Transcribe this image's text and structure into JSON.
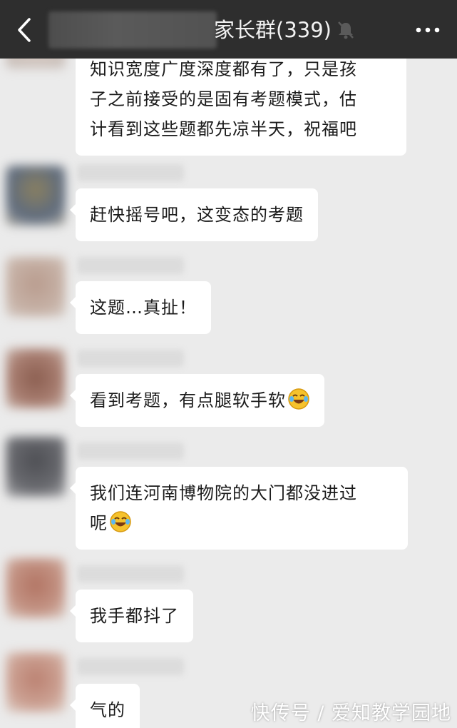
{
  "header": {
    "title": "家长群(339)",
    "back_icon": "chevron-left-icon",
    "mute_icon": "bell-muted-icon",
    "more_label": "···"
  },
  "messages": [
    {
      "lines": [
        "知识宽度广度深度都有了，只是孩",
        "子之前接受的是固有考题模式，估",
        "计看到这些题都先凉半天，祝福吧"
      ]
    },
    {
      "text": "赶快摇号吧，这变态的考题"
    },
    {
      "text": "这题…真扯！"
    },
    {
      "text": "看到考题，有点腿软手软",
      "emoji": "laughing-crying-emoji"
    },
    {
      "lines": [
        "我们连河南博物院的大门都没进过",
        "呢"
      ],
      "emoji": "laughing-crying-emoji"
    },
    {
      "text": "我手都抖了"
    },
    {
      "text": "气的"
    }
  ],
  "watermark": "快传号 / 爱知教学园地",
  "colors": {
    "topbar": "#2e2e2e",
    "background": "#ebebeb",
    "bubble": "#ffffff"
  }
}
